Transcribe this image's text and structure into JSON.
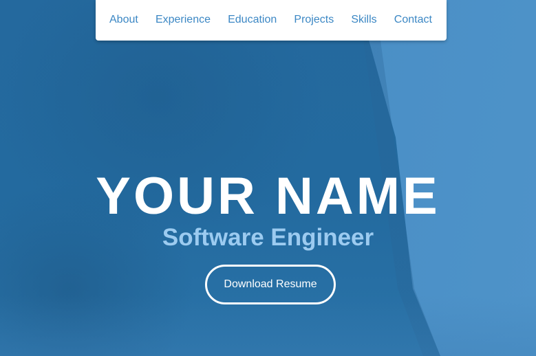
{
  "nav": {
    "items": [
      {
        "label": "About"
      },
      {
        "label": "Experience"
      },
      {
        "label": "Education"
      },
      {
        "label": "Projects"
      },
      {
        "label": "Skills"
      },
      {
        "label": "Contact"
      }
    ]
  },
  "hero": {
    "name": "YOUR NAME",
    "title": "Software Engineer",
    "button_label": "Download Resume"
  },
  "colors": {
    "nav_link": "#3b87c4",
    "hero_background": "#22679c",
    "title_text": "#9ccbf0",
    "name_text": "#ffffff"
  }
}
